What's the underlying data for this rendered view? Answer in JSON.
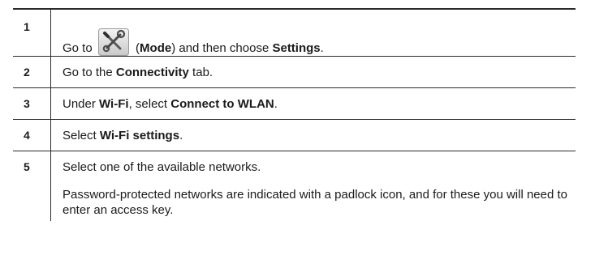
{
  "steps": [
    {
      "number": "1",
      "text": {
        "pre": "Go to ",
        "icon": "mode-tools-icon",
        "paren_open": " (",
        "mode": "Mode",
        "paren_close": ") and then choose ",
        "settings": "Settings",
        "end": "."
      }
    },
    {
      "number": "2",
      "text": {
        "pre": "Go to the ",
        "connectivity": "Connectivity",
        "end": " tab."
      }
    },
    {
      "number": "3",
      "text": {
        "pre": "Under ",
        "wifi": "Wi-Fi",
        "mid": ", select ",
        "connect": "Connect to WLAN",
        "end": "."
      }
    },
    {
      "number": "4",
      "text": {
        "pre": "Select ",
        "wifi_settings": "Wi-Fi settings",
        "end": "."
      }
    },
    {
      "number": "5",
      "text": {
        "line1": "Select one of the available networks.",
        "line2": "Password-protected networks are indicated with a padlock icon, and for these you will need to enter an access key."
      }
    }
  ]
}
